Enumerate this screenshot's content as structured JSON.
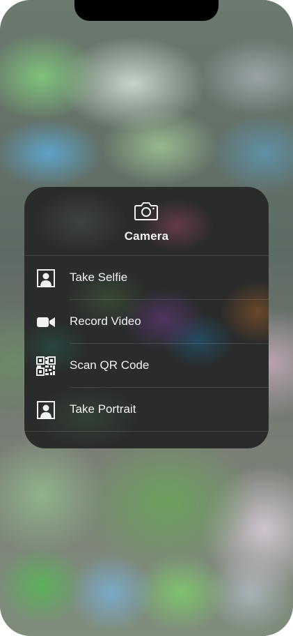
{
  "menu": {
    "title": "Camera",
    "header_icon": "camera-icon",
    "items": [
      {
        "label": "Take Selfie",
        "icon": "selfie-portrait-icon"
      },
      {
        "label": "Record Video",
        "icon": "video-camera-icon"
      },
      {
        "label": "Scan QR Code",
        "icon": "qr-code-icon"
      },
      {
        "label": "Take Portrait",
        "icon": "portrait-icon"
      }
    ]
  },
  "colors": {
    "menu_background": "#2a2c2c",
    "text": "#f2f2f2"
  }
}
